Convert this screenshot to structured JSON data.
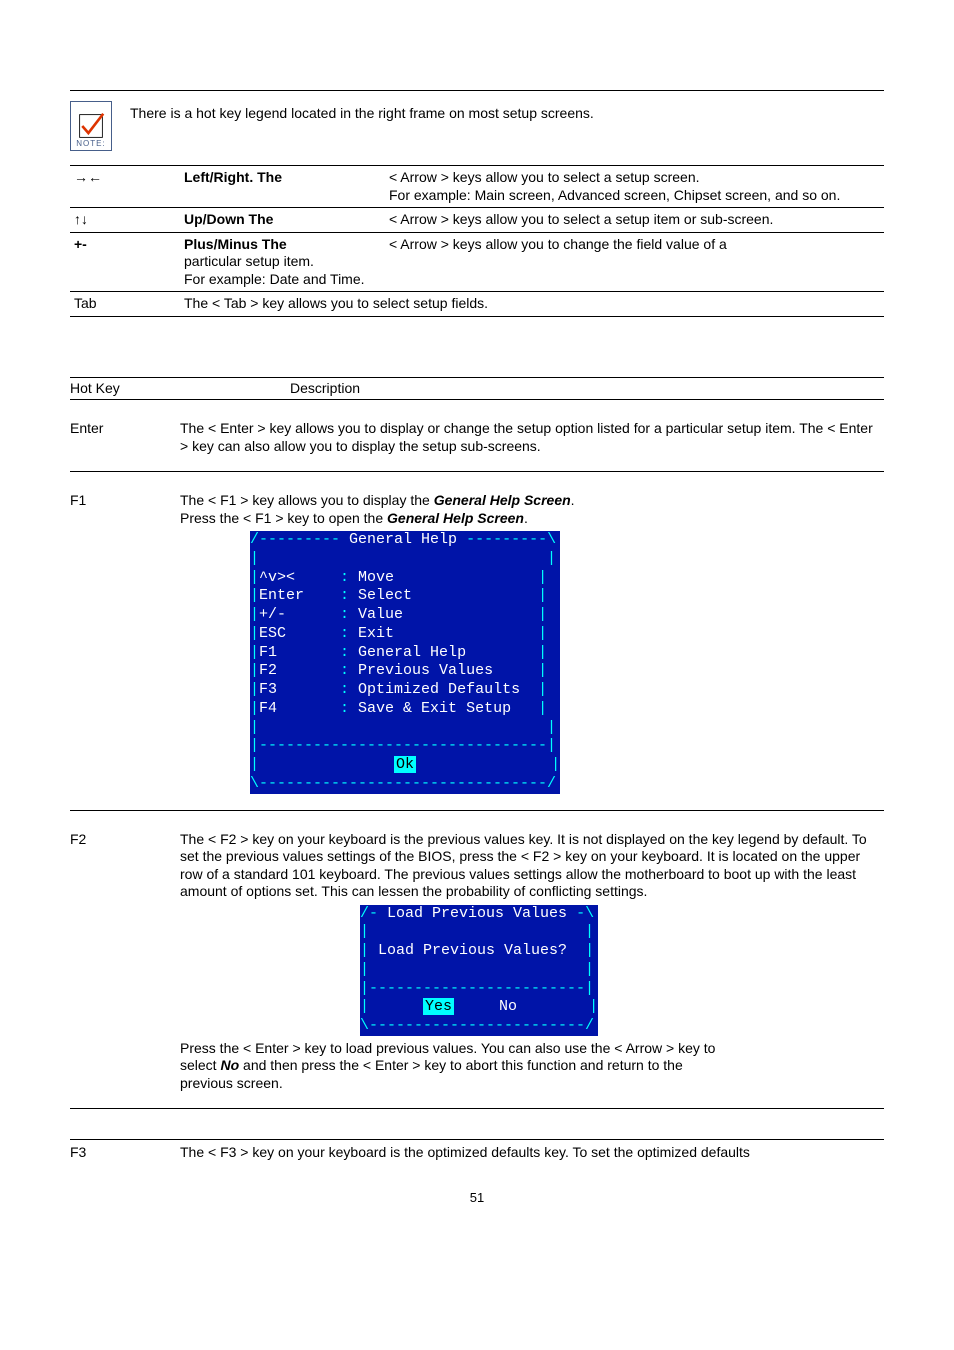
{
  "note": {
    "label": "NOTE:",
    "text": "There is a hot key legend located in the right frame on most setup screens."
  },
  "nav_table": [
    {
      "sym": "→←",
      "label": "Left/Right. The",
      "desc1": "< Arrow > keys allow you to select a setup screen.",
      "desc2": "For example: Main screen, Advanced screen, Chipset screen, and so on."
    },
    {
      "sym": "↑↓",
      "label": "Up/Down The",
      "desc1": "< Arrow > keys allow you to select a setup item or sub-screen.",
      "desc2": ""
    },
    {
      "sym": "+-",
      "label": "Plus/Minus The",
      "desc1": "< Arrow > keys allow you to change the field value of a",
      "extra1": "particular setup item.",
      "extra2": "For example: Date and Time."
    },
    {
      "sym": "Tab",
      "full": "The < Tab > key allows you to select setup fields."
    }
  ],
  "hotkey_header": {
    "c1": "Hot Key",
    "c2": "Description"
  },
  "enter": {
    "key": "Enter",
    "text": "The < Enter > key allows you to display or change the setup option listed for a particular setup item. The < Enter > key can also allow you to display the setup sub-screens."
  },
  "f1": {
    "key": "F1",
    "line1": "The < F1 > key allows you to display the ",
    "line1_tail": ".",
    "line2a": "Press the < F1 > key to open the ",
    "line2_tail": "."
  },
  "terminal1": {
    "title_dashes_l": "/--------- ",
    "title": "General Help",
    "title_dashes_r": " ---------\\",
    "rows": [
      {
        "k": "^v><",
        "v": "Move"
      },
      {
        "k": "Enter",
        "v": "Select"
      },
      {
        "k": "+/-",
        "v": "Value"
      },
      {
        "k": "ESC",
        "v": "Exit"
      },
      {
        "k": "F1",
        "v": "General Help"
      },
      {
        "k": "F2",
        "v": "Previous Values"
      },
      {
        "k": "F3",
        "v": "Optimized Defaults"
      },
      {
        "k": "F4",
        "v": "Save & Exit Setup"
      }
    ],
    "ok": "Ok"
  },
  "f2": {
    "key": "F2",
    "text": "The < F2 > key on your keyboard is the previous values key. It is not displayed on the key legend by default. To set the previous values settings of the BIOS, press the < F2 > key on your keyboard. It is located on the upper row of a standard 101 keyboard. The previous values settings allow the motherboard to boot up with the least amount of options set. This can lessen the probability of conflicting settings."
  },
  "terminal2": {
    "title": " Load Previous Values ",
    "body": " Load Previous Values? ",
    "yes": "Yes",
    "no": "No"
  },
  "f2_tail": {
    "l1": "Press the < Enter > key to load previous values. You can also use the < Arrow > key to",
    "l2a": "select ",
    "l2b": " and then press the < Enter > key to abort this function and return to the",
    "l3": "previous screen."
  },
  "f3": {
    "key": "F3",
    "text": "The < F3 > key on your keyboard is the optimized defaults key. To set the optimized defaults"
  },
  "page_num": "51"
}
